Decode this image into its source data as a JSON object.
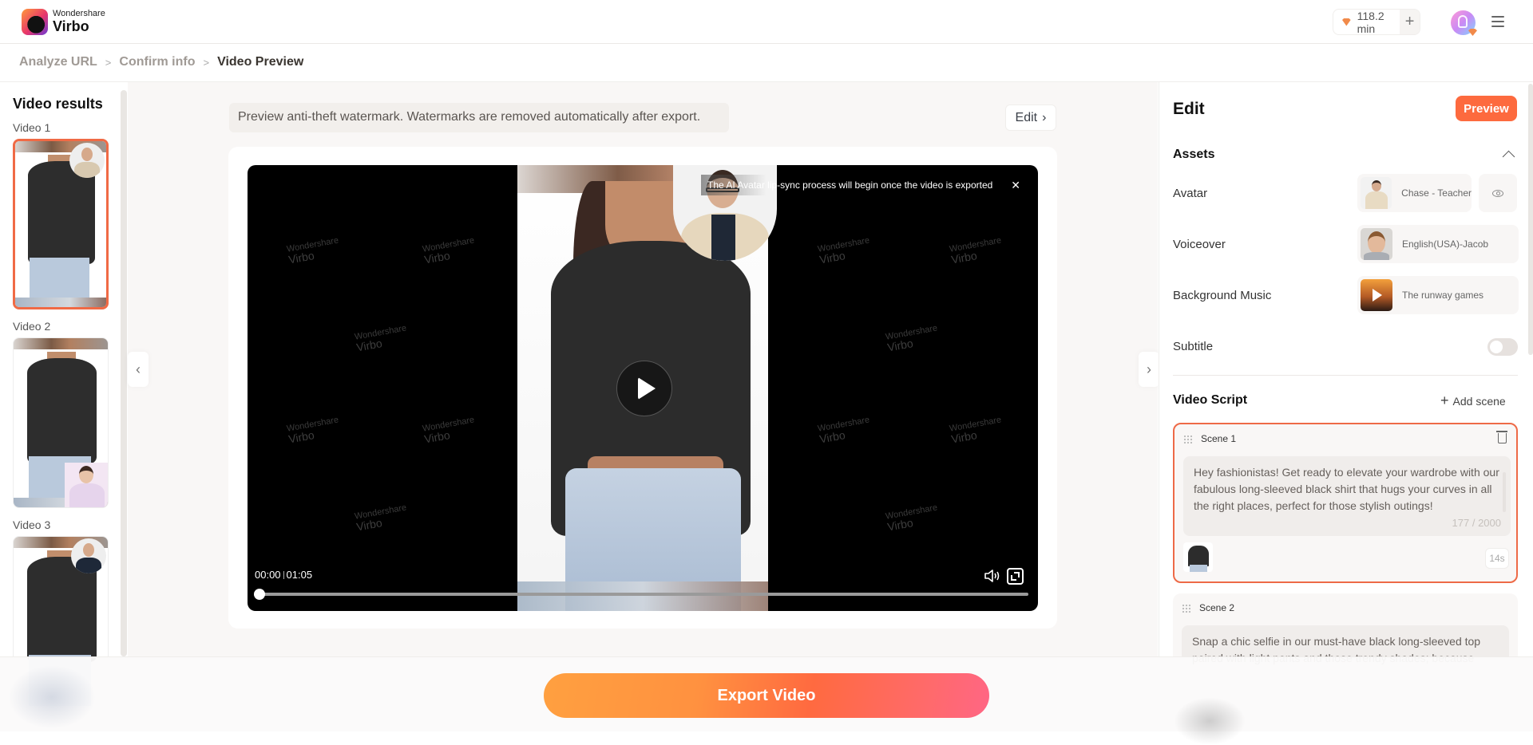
{
  "app": {
    "brand_small": "Wondershare",
    "brand_big": "Virbo",
    "credits": "118.2 min",
    "accent_color": "#fd6a3e"
  },
  "breadcrumb": [
    {
      "label": "Analyze URL"
    },
    {
      "label": "Confirm info"
    },
    {
      "label": "Video Preview"
    }
  ],
  "sidebar": {
    "title": "Video results",
    "videos": [
      {
        "label": "Video  1",
        "selected": true
      },
      {
        "label": "Video  2",
        "selected": false
      },
      {
        "label": "Video  3",
        "selected": false
      }
    ]
  },
  "preview": {
    "notice": "Preview anti-theft watermark. Watermarks are removed automatically after export.",
    "edit_label": "Edit",
    "toast": "The AI Avatar lip-sync process will begin once the video is exported",
    "watermark_small": "Wondershare",
    "watermark_big": "Virbo",
    "current_time": "00:00",
    "duration": "01:05",
    "progress": 0
  },
  "edit_panel": {
    "title": "Edit",
    "preview_button": "Preview",
    "assets_title": "Assets",
    "assets": [
      {
        "label": "Avatar",
        "value": "Chase - Teacher"
      },
      {
        "label": "Voiceover",
        "value": "English(USA)-Jacob"
      },
      {
        "label": "Background Music",
        "value": "The runway games"
      }
    ],
    "subtitle_label": "Subtitle",
    "subtitle_enabled": false,
    "script_title": "Video Script",
    "add_scene": "Add scene",
    "scenes": [
      {
        "label": "Scene 1",
        "text": "Hey fashionistas! Get ready to elevate your wardrobe with our fabulous long-sleeved black shirt that hugs your curves in all the right places, perfect for those stylish outings!",
        "counter": "177 / 2000",
        "duration": "14s"
      },
      {
        "label": "Scene 2",
        "text": "Snap a chic selfie in our must-have black long-sleeved top paired with light pants and those trendy shades; because"
      }
    ]
  },
  "footer": {
    "export_button": "Export Video"
  }
}
